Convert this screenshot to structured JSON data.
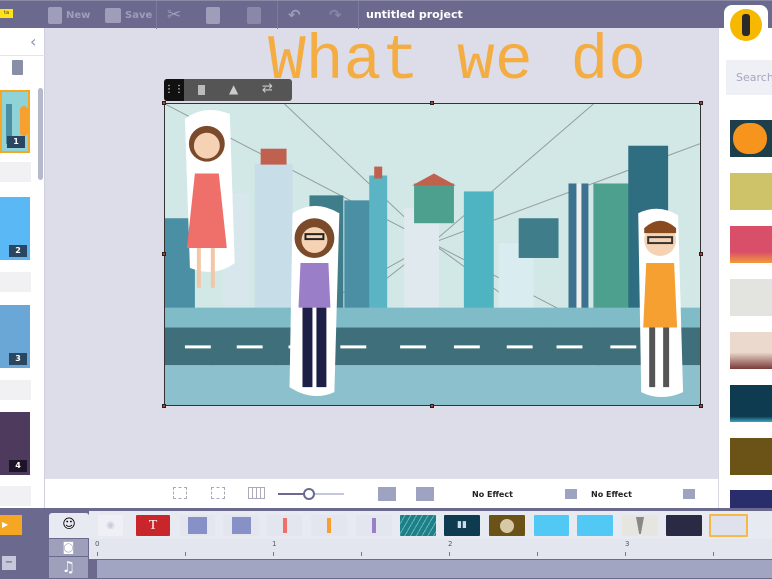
{
  "topbar": {
    "badge": "ta",
    "new_label": "New",
    "save_label": "Save",
    "project_title": "untitled project"
  },
  "canvas": {
    "title_text": "What we do",
    "title_color": "#f5a936"
  },
  "slides": [
    {
      "num": "1",
      "color": "#8fd3d8"
    },
    {
      "num": "2",
      "color": "#5ab8f5"
    },
    {
      "num": "3",
      "color": "#6aa6d6"
    },
    {
      "num": "4",
      "color": "#4e3a5c"
    }
  ],
  "controls": {
    "zoom_level": 0.45,
    "effect_in": "No Effect",
    "effect_out": "No Effect"
  },
  "right_panel": {
    "search_placeholder": "Search",
    "thumbs": [
      "#f7941d",
      "#cfc36a",
      "#d94f6a",
      "#e3e3df",
      "#ead9cc",
      "#0e3b4f",
      "#6b5318",
      "#2a2d6b"
    ]
  },
  "timeline": {
    "ruler": [
      "0",
      "1",
      "2",
      "3"
    ],
    "thumbs": [
      {
        "kind": "eye",
        "color": "#eef0f6"
      },
      {
        "kind": "text",
        "label": "T",
        "color": "#c9262b"
      },
      {
        "kind": "shape",
        "color": "#8890c8"
      },
      {
        "kind": "shape",
        "color": "#8890c8"
      },
      {
        "kind": "character",
        "color": "#e4e6ef"
      },
      {
        "kind": "character",
        "color": "#e4e6ef"
      },
      {
        "kind": "character",
        "color": "#e4e6ef"
      },
      {
        "kind": "rain",
        "color": "#1f7f86"
      },
      {
        "kind": "audio-wave",
        "color": "#0e3b4f"
      },
      {
        "kind": "smoke",
        "color": "#6b5318"
      },
      {
        "kind": "snow",
        "color": "#52c8f5"
      },
      {
        "kind": "snow",
        "color": "#52c8f5"
      },
      {
        "kind": "tornado",
        "color": "#e6e5df"
      },
      {
        "kind": "stars",
        "color": "#2b2a45"
      },
      {
        "kind": "burst-selected",
        "color": "#dfe2ec"
      }
    ]
  }
}
